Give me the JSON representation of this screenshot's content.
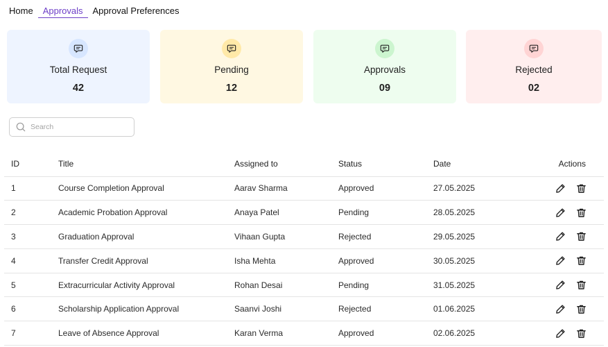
{
  "nav": {
    "tabs": [
      {
        "label": "Home"
      },
      {
        "label": "Approvals"
      },
      {
        "label": "Approval Preferences"
      }
    ],
    "active_tab": "Approvals"
  },
  "stats": [
    {
      "label": "Total Request",
      "value": "42",
      "bg": "#eef4ff",
      "badge": "#d7e6ff",
      "icon": "chat-bubble-icon"
    },
    {
      "label": "Pending",
      "value": "12",
      "bg": "#fff8e2",
      "badge": "#ffe9a8",
      "icon": "chat-bubble-icon"
    },
    {
      "label": "Approvals",
      "value": "09",
      "bg": "#eefdef",
      "badge": "#ccf5cf",
      "icon": "chat-bubble-icon"
    },
    {
      "label": "Rejected",
      "value": "02",
      "bg": "#ffeeee",
      "badge": "#ffd4d4",
      "icon": "chat-bubble-icon"
    }
  ],
  "search": {
    "placeholder": "Search",
    "value": ""
  },
  "table": {
    "columns": [
      "ID",
      "Title",
      "Assigned to",
      "Status",
      "Date",
      "Actions"
    ],
    "rows": [
      {
        "id": "1",
        "title": "Course Completion Approval",
        "assigned": "Aarav Sharma",
        "status": "Approved",
        "date": "27.05.2025"
      },
      {
        "id": "2",
        "title": "Academic Probation Approval",
        "assigned": "Anaya Patel",
        "status": "Pending",
        "date": "28.05.2025"
      },
      {
        "id": "3",
        "title": "Graduation Approval",
        "assigned": "Vihaan Gupta",
        "status": "Rejected",
        "date": "29.05.2025"
      },
      {
        "id": "4",
        "title": "Transfer Credit Approval",
        "assigned": "Isha Mehta",
        "status": "Approved",
        "date": "30.05.2025"
      },
      {
        "id": "5",
        "title": "Extracurricular Activity Approval",
        "assigned": "Rohan Desai",
        "status": "Pending",
        "date": "31.05.2025"
      },
      {
        "id": "6",
        "title": "Scholarship Application Approval",
        "assigned": "Saanvi Joshi",
        "status": "Rejected",
        "date": "01.06.2025"
      },
      {
        "id": "7",
        "title": "Leave of Absence Approval",
        "assigned": "Karan Verma",
        "status": "Approved",
        "date": "02.06.2025"
      }
    ],
    "row_actions": [
      "edit-icon",
      "trash-icon"
    ]
  },
  "colors": {
    "accent": "#6d3fc7",
    "border": "#e4e4e4"
  }
}
